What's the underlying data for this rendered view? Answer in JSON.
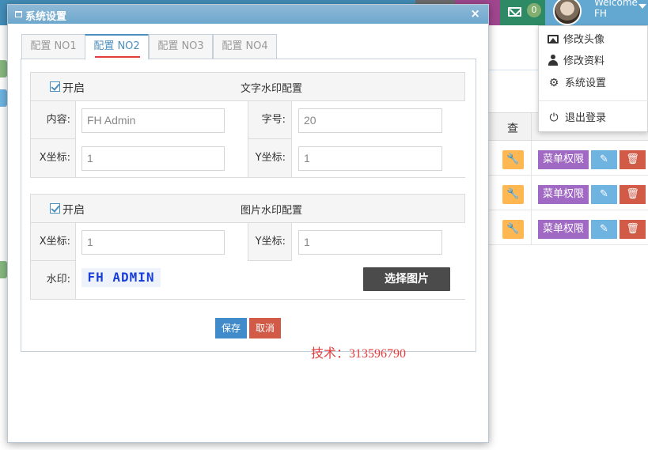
{
  "topbar": {
    "messages_count": "0",
    "dark_count": "2",
    "user": {
      "line1": "Welcome",
      "line2": "FH"
    }
  },
  "user_menu": {
    "items": [
      {
        "label": "修改头像",
        "icon": "image-icon"
      },
      {
        "label": "修改资料",
        "icon": "user-icon"
      },
      {
        "label": "系统设置",
        "icon": "gear-icon"
      },
      {
        "label": "退出登录",
        "icon": "power-icon"
      }
    ]
  },
  "background_table": {
    "header": "查",
    "row_button": "菜单权限",
    "rows": 3
  },
  "modal": {
    "title": "系统设置",
    "close": "×",
    "tabs": [
      "配置 NO1",
      "配置 NO2",
      "配置 NO3",
      "配置 NO4"
    ],
    "active_tab": 1,
    "text_watermark": {
      "enable_label": "开启",
      "caption": "文字水印配置",
      "content_label": "内容:",
      "content_value": "FH Admin",
      "fontsize_label": "字号:",
      "fontsize_value": "20",
      "x_label": "X坐标:",
      "x_value": "1",
      "y_label": "Y坐标:",
      "y_value": "1"
    },
    "image_watermark": {
      "enable_label": "开启",
      "caption": "图片水印配置",
      "x_label": "X坐标:",
      "x_value": "1",
      "y_label": "Y坐标:",
      "y_value": "1",
      "watermark_label": "水印:",
      "watermark_sample": "FH ADMIN",
      "pick_button": "选择图片"
    },
    "save": "保存",
    "cancel": "取消"
  },
  "tech_note": "技术：313596790",
  "colors": {
    "topbar": "#438eb9",
    "accent": "#4c8fbd",
    "danger": "#d15b47",
    "save": "#428bca"
  }
}
